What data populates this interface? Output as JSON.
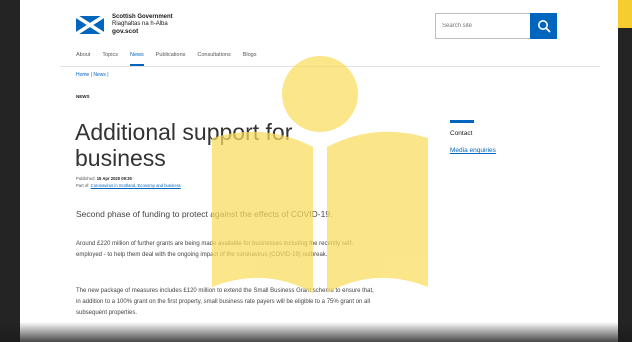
{
  "header": {
    "brand_line1": "Scottish Government",
    "brand_line2": "Riaghaltas na h-Alba",
    "brand_line3": "gov.scot",
    "search_placeholder": "Search site",
    "flag_colors": {
      "blue": "#0065bd",
      "white": "#ffffff"
    }
  },
  "nav": {
    "items": [
      {
        "label": "About"
      },
      {
        "label": "Topics"
      },
      {
        "label": "News"
      },
      {
        "label": "Publications"
      },
      {
        "label": "Consultations"
      },
      {
        "label": "Blogs"
      }
    ],
    "active_index": 2
  },
  "breadcrumb": "Home | News |",
  "article": {
    "label": "NEWS",
    "title": "Additional support for business",
    "published_prefix": "Published: ",
    "published_date": "15 Apr 2020 09:30",
    "part_of_prefix": "Part of: ",
    "part_of_links": "Coronavirus in Scotland, Economy and business",
    "lead": "Second phase of funding to protect against the effects of COVID-19.",
    "para1": "Around £220 million of further grants are being made available for businesses including the recently self-employed - to help them deal with the ongoing impact of the coronavirus (COVID-19) outbreak.",
    "para2": "The new package of measures includes £120 million to extend the Small Business Grant scheme to ensure that, in addition to a 100% grant on the first property, small business rate payers will be eligible to a 75% grant on all subsequent properties."
  },
  "sidebar": {
    "heading": "Contact",
    "link": "Media enquiries"
  },
  "overlay": {
    "icon": "open-book-reader-icon",
    "color": "#f9dd5c",
    "corner_color": "#f5cd2f"
  },
  "accent": "#0065bd"
}
